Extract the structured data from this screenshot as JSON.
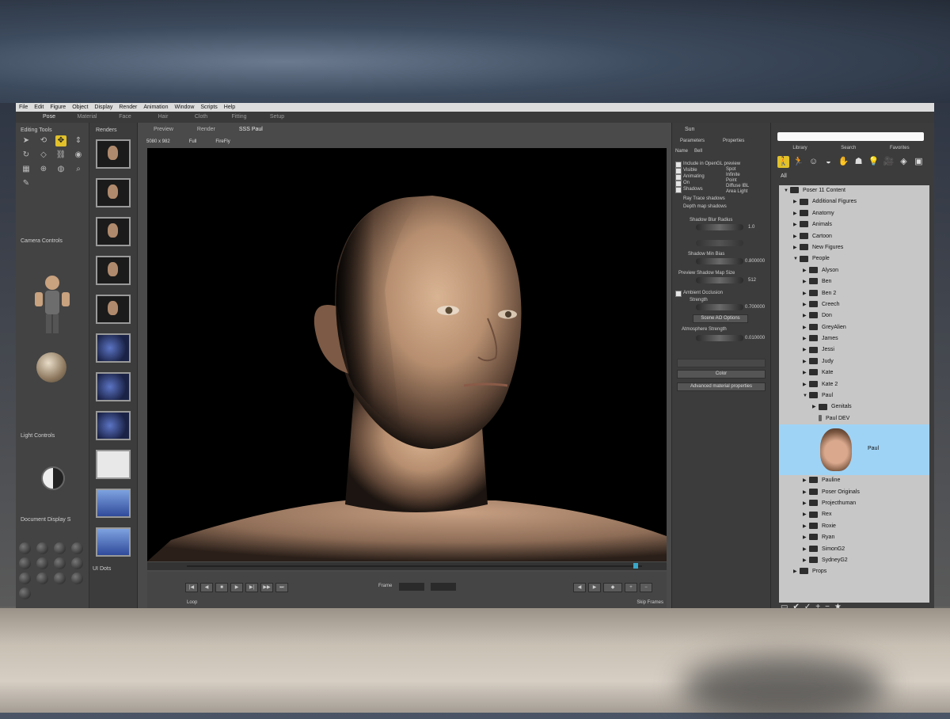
{
  "menu": [
    "File",
    "Edit",
    "Figure",
    "Object",
    "Display",
    "Render",
    "Animation",
    "Window",
    "Scripts",
    "Help"
  ],
  "rooms": [
    "Pose",
    "Material",
    "Face",
    "Hair",
    "Cloth",
    "Fitting",
    "Setup"
  ],
  "left_panel": {
    "editing_tools_title": "Editing Tools",
    "camera_controls_title": "Camera Controls",
    "light_controls_title": "Light Controls",
    "document_display_title": "Document Display S",
    "ui_dots_title": "UI Dots"
  },
  "renders_title": "Renders",
  "viewport": {
    "tabs": [
      "Preview",
      "Render",
      "SSS Paul"
    ],
    "size": "5080 x 982",
    "mode": "Full",
    "renderer": "FireFly"
  },
  "anim": {
    "frame_label": "Frame",
    "loop_label": "Loop",
    "skip_label": "Skip Frames"
  },
  "params_panel": {
    "title": "Sun",
    "tabs": [
      "Parameters",
      "Properties"
    ],
    "subtabs": [
      "Name",
      "Bell"
    ],
    "left_checks": [
      "Include in OpenGL preview",
      "Visible",
      "Animating",
      "On",
      "Shadows"
    ],
    "right_checks": [
      "Spot",
      "Infinite",
      "Point",
      "Diffuse IBL",
      "Area Light"
    ],
    "radio1": "Ray Trace shadows",
    "radio2": "Depth map shadows",
    "shadow_blur_label": "Shadow Blur Radius",
    "shadow_blur_value": "1.0",
    "shadow_min_bias_label": "Shadow Min Bias",
    "shadow_min_bias_value": "0.800000",
    "preview_shadow_label": "Preview Shadow Map Size",
    "preview_shadow_value": "512",
    "ambient_occlusion": "Ambient Occlusion",
    "strength_label": "Strength",
    "strength_value": "0.700000",
    "scene_ao_button": "Scene AO Options",
    "atmosphere_label": "Atmosphere Strength",
    "atmosphere_value": "0.010000",
    "color_button": "Color",
    "advanced_button": "Advanced material properties"
  },
  "library": {
    "tabs": [
      "Library",
      "Search",
      "Favorites"
    ],
    "filter": "All",
    "tree": [
      {
        "label": "Poser 11 Content",
        "depth": 0,
        "open": true
      },
      {
        "label": "Additional Figures",
        "depth": 1
      },
      {
        "label": "Anatomy",
        "depth": 1
      },
      {
        "label": "Animals",
        "depth": 1
      },
      {
        "label": "Cartoon",
        "depth": 1
      },
      {
        "label": "New Figures",
        "depth": 1
      },
      {
        "label": "People",
        "depth": 1,
        "open": true
      },
      {
        "label": "Alyson",
        "depth": 2
      },
      {
        "label": "Ben",
        "depth": 2
      },
      {
        "label": "Ben 2",
        "depth": 2
      },
      {
        "label": "Creech",
        "depth": 2
      },
      {
        "label": "Don",
        "depth": 2
      },
      {
        "label": "GreyAlien",
        "depth": 2
      },
      {
        "label": "James",
        "depth": 2
      },
      {
        "label": "Jessi",
        "depth": 2
      },
      {
        "label": "Judy",
        "depth": 2
      },
      {
        "label": "Kate",
        "depth": 2
      },
      {
        "label": "Kate 2",
        "depth": 2
      },
      {
        "label": "Paul",
        "depth": 2,
        "open": true
      },
      {
        "label": "Genitals",
        "depth": 3
      },
      {
        "label": "Paul DEV",
        "depth": 3,
        "leaf": true
      }
    ],
    "selected_item": "Paul",
    "tree_after": [
      {
        "label": "Pauline",
        "depth": 2
      },
      {
        "label": "Poser Originals",
        "depth": 2
      },
      {
        "label": "Projecthuman",
        "depth": 2
      },
      {
        "label": "Rex",
        "depth": 2
      },
      {
        "label": "Roxie",
        "depth": 2
      },
      {
        "label": "Ryan",
        "depth": 2
      },
      {
        "label": "SimonG2",
        "depth": 2
      },
      {
        "label": "SydneyG2",
        "depth": 2
      },
      {
        "label": "Props",
        "depth": 1
      }
    ]
  }
}
